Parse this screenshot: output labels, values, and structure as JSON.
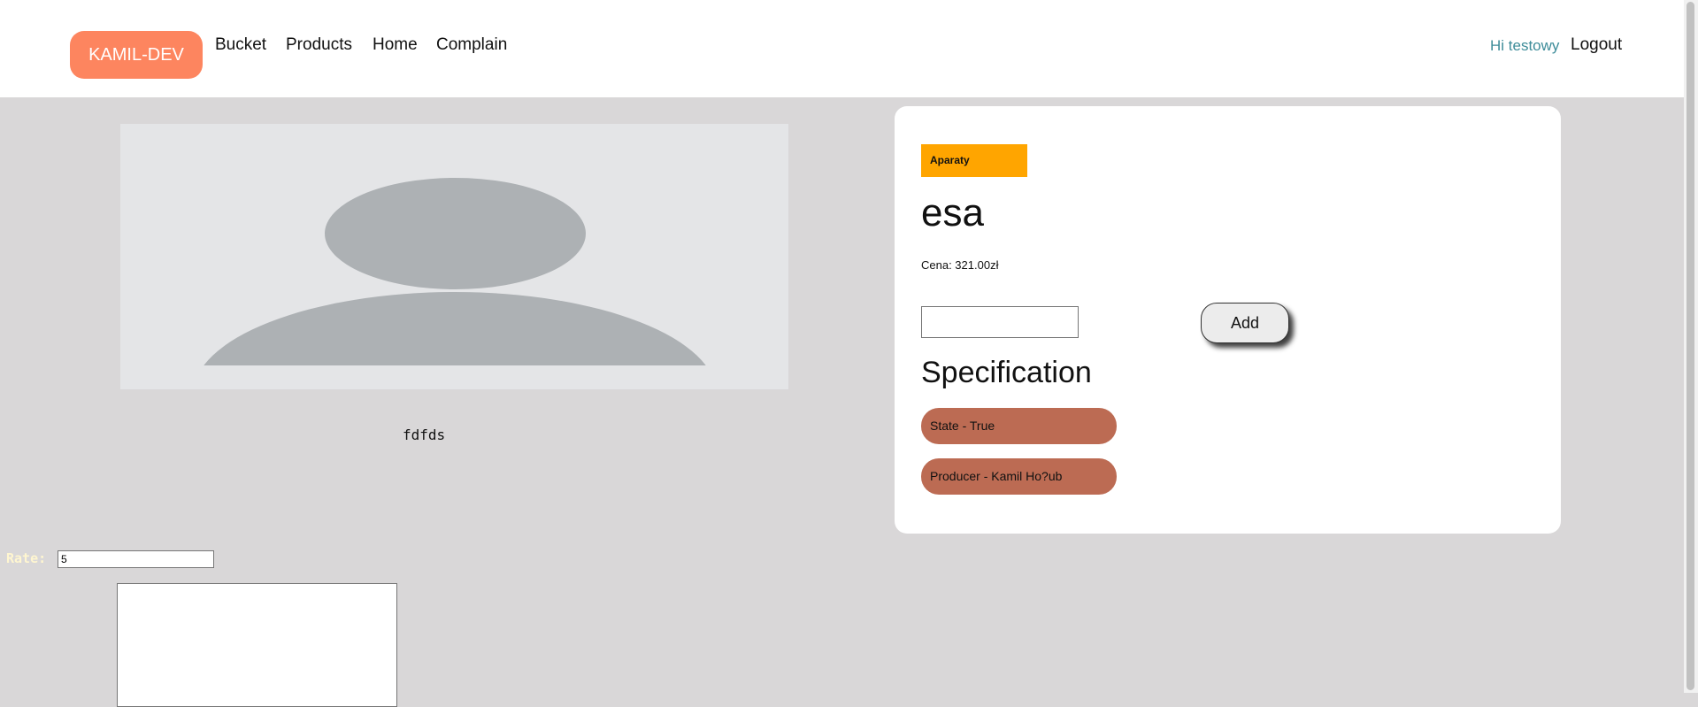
{
  "nav": {
    "brand": "KAMIL-DEV",
    "links": [
      "Bucket",
      "Products",
      "Home",
      "Complain"
    ],
    "greeting": "Hi testowy",
    "logout": "Logout"
  },
  "product": {
    "description": "fdfds",
    "category": "Aparaty",
    "name": "esa",
    "price": "Cena: 321.00zł",
    "quantity_value": "",
    "add_label": "Add",
    "spec_title": "Specification",
    "specs": [
      "State - True",
      "Producer - Kamil Ho?ub"
    ]
  },
  "review": {
    "rate_label": "Rate:",
    "rate_value": "5",
    "comment_value": ""
  },
  "colors": {
    "brand": "#fd855f",
    "category": "#ffa500",
    "spec_pill": "#bc6b53",
    "greeting": "#3d8c99",
    "page_bg": "#d9d7d8"
  },
  "icons": {
    "placeholder_image": "avatar-placeholder-icon"
  }
}
